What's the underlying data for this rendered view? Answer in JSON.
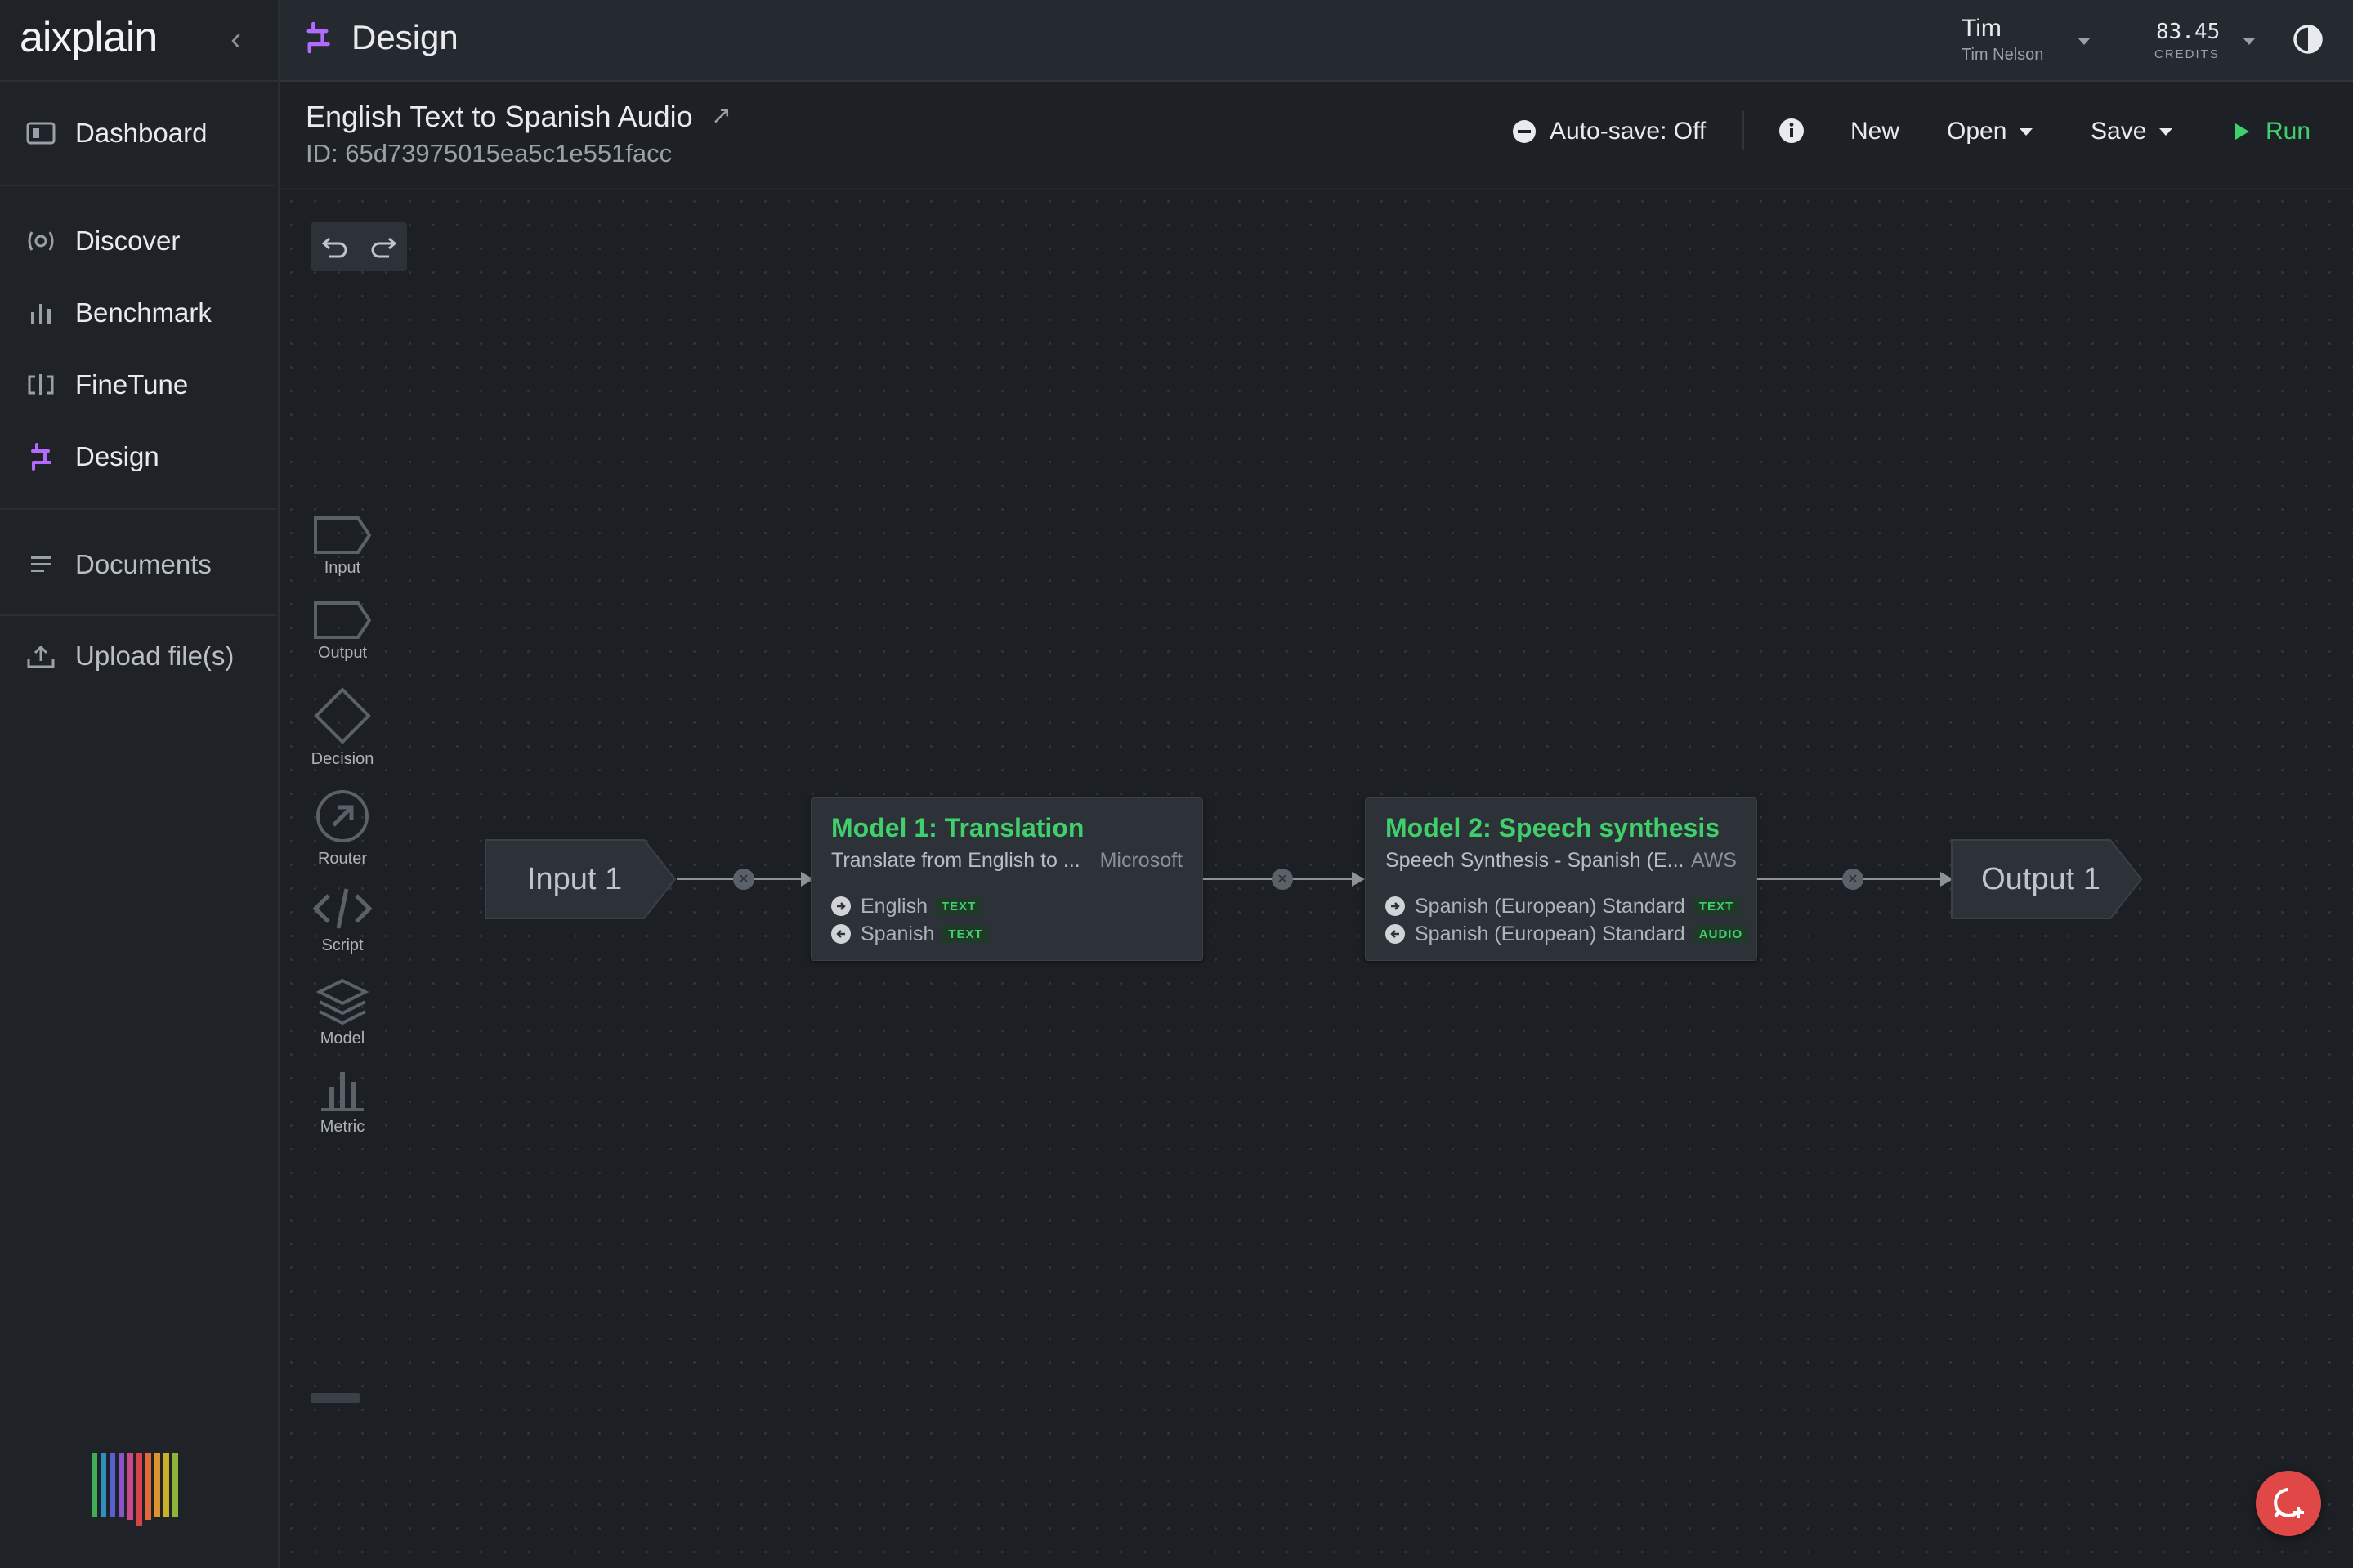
{
  "brand": {
    "logo": "aixplain"
  },
  "header": {
    "section_title": "Design",
    "user": {
      "name": "Tim",
      "full_name": "Tim Nelson"
    },
    "credits": {
      "value": "83.45",
      "label": "CREDITS"
    }
  },
  "sidebar": {
    "items": [
      {
        "label": "Dashboard",
        "icon": "dashboard-icon"
      },
      {
        "label": "Discover",
        "icon": "discover-icon"
      },
      {
        "label": "Benchmark",
        "icon": "benchmark-icon"
      },
      {
        "label": "FineTune",
        "icon": "finetune-icon"
      },
      {
        "label": "Design",
        "icon": "design-icon",
        "active": true
      },
      {
        "label": "Documents",
        "icon": "documents-icon"
      },
      {
        "label": "Upload file(s)",
        "icon": "upload-icon"
      }
    ]
  },
  "pipeline": {
    "name": "English Text to Spanish Audio",
    "id": "ID: 65d73975015ea5c1e551facc"
  },
  "toolbar": {
    "autosave": "Auto-save: Off",
    "new": "New",
    "open": "Open",
    "save": "Save",
    "run": "Run"
  },
  "palette": {
    "tools": [
      "Input",
      "Output",
      "Decision",
      "Router",
      "Script",
      "Model",
      "Metric"
    ]
  },
  "nodes": {
    "input": {
      "label": "Input 1"
    },
    "model1": {
      "title": "Model 1: Translation",
      "description": "Translate from English to ...",
      "vendor": "Microsoft",
      "ports": [
        {
          "label": "English",
          "type": "TEXT",
          "direction": "in"
        },
        {
          "label": "Spanish",
          "type": "TEXT",
          "direction": "out"
        }
      ]
    },
    "model2": {
      "title": "Model 2: Speech synthesis",
      "description": "Speech Synthesis - Spanish (E...",
      "vendor": "AWS",
      "ports": [
        {
          "label": "Spanish (European) Standard",
          "type": "TEXT",
          "direction": "in"
        },
        {
          "label": "Spanish (European) Standard",
          "type": "AUDIO",
          "direction": "out"
        }
      ]
    },
    "output": {
      "label": "Output 1"
    }
  },
  "colors": {
    "accent_green": "#3fd06c",
    "design_purple": "#b36bff",
    "fab_red": "#e04848"
  }
}
